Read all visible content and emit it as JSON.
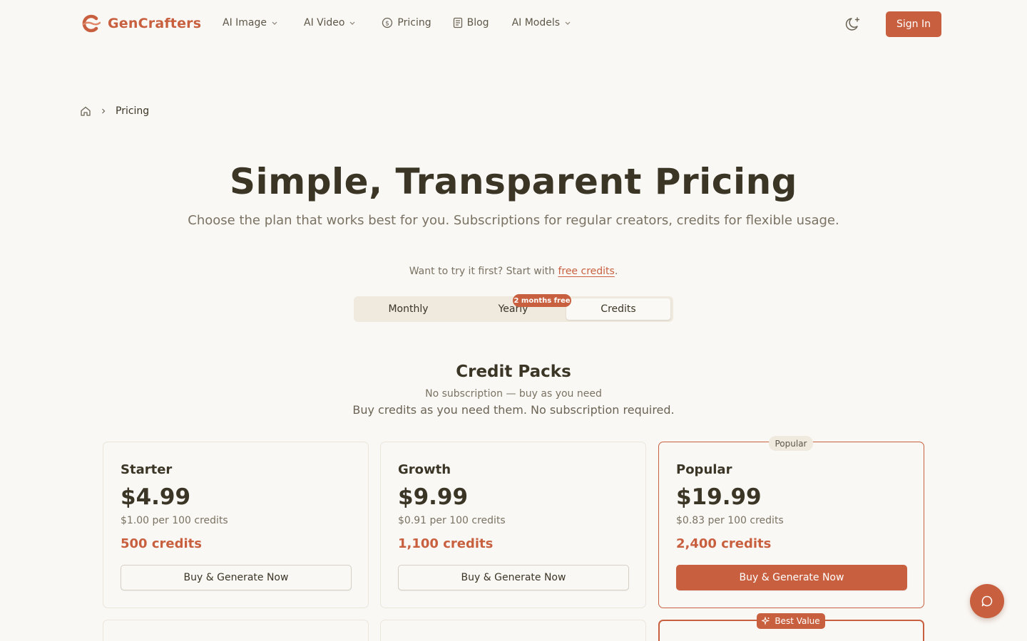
{
  "brand": {
    "name": "GenCrafters",
    "accent": "#c8603f"
  },
  "nav": {
    "items": [
      {
        "label": "AI Image",
        "icon": "chevron-down-icon"
      },
      {
        "label": "AI Video",
        "icon": "chevron-down-icon"
      },
      {
        "label": "Pricing",
        "icon": "dollar-circle-icon"
      },
      {
        "label": "Blog",
        "icon": "document-icon"
      },
      {
        "label": "AI Models",
        "icon": "chevron-down-icon"
      }
    ],
    "theme_icon": "moon-sparkle-icon",
    "signin_label": "Sign In"
  },
  "breadcrumb": {
    "home_icon": "home-icon",
    "current": "Pricing"
  },
  "hero": {
    "title": "Simple, Transparent Pricing",
    "subtitle": "Choose the plan that works best for you. Subscriptions for regular creators, credits for flexible usage.",
    "try_prefix": "Want to try it first? Start with ",
    "try_link": "free credits",
    "try_suffix": "."
  },
  "billing_toggle": {
    "options": [
      "Monthly",
      "Yearly",
      "Credits"
    ],
    "selected": "Credits",
    "yearly_badge": "2 months free"
  },
  "section": {
    "title": "Credit Packs",
    "subtitle": "No subscription — buy as you need",
    "description": "Buy credits as you need them. No subscription required."
  },
  "packs": [
    {
      "name": "Starter",
      "price": "$4.99",
      "per_unit": "$1.00 per 100 credits",
      "credits": "500 credits",
      "button": "Buy & Generate Now",
      "tag": ""
    },
    {
      "name": "Growth",
      "price": "$9.99",
      "per_unit": "$0.91 per 100 credits",
      "credits": "1,100 credits",
      "button": "Buy & Generate Now",
      "tag": ""
    },
    {
      "name": "Popular",
      "price": "$19.99",
      "per_unit": "$0.83 per 100 credits",
      "credits": "2,400 credits",
      "button": "Buy & Generate Now",
      "tag": "Popular"
    }
  ],
  "next_row": {
    "best_value_tag": "Best Value"
  },
  "chat": {
    "icon": "chat-bubble-icon"
  }
}
